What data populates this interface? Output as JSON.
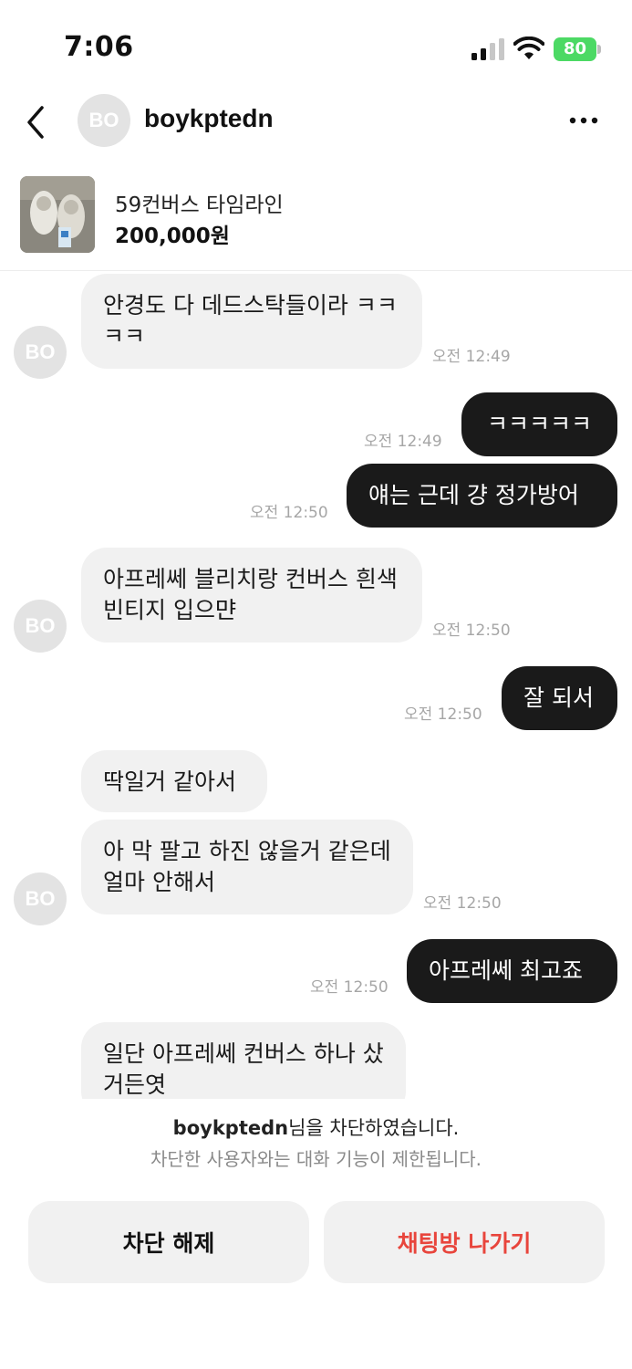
{
  "status_bar": {
    "time": "7:06",
    "battery": "80"
  },
  "header": {
    "back_icon": "chevron-left-icon",
    "avatar_initials": "BO",
    "name": "boykptedn",
    "more_icon": "more-horizontal-icon"
  },
  "product": {
    "title": "59컨버스 타임라인",
    "price": "200,000원"
  },
  "messages": [
    {
      "from": "them",
      "text": "안경도 다 데드스탁들이라 ㅋㅋㅋㅋ",
      "time": "오전 12:49"
    },
    {
      "from": "me",
      "text": "ㅋㅋㅋㅋㅋ",
      "time": "오전 12:49"
    },
    {
      "from": "me",
      "text": "얘는 근데 걍 정가방어",
      "time": "오전 12:50"
    },
    {
      "from": "them",
      "text": "아프레쎄 블리치랑 컨버스 흰색 빈티지 입으먄",
      "time": "오전 12:50"
    },
    {
      "from": "me",
      "text": "잘 되서",
      "time": "오전 12:50"
    },
    {
      "from": "them",
      "text": "딱일거 같아서",
      "time": ""
    },
    {
      "from": "them",
      "text": "아 막 팔고 하진 않을거 같은데 얼마 안해서",
      "time": "오전 12:50"
    },
    {
      "from": "me",
      "text": "아프레쎄 최고죠",
      "time": "오전 12:50"
    },
    {
      "from": "them",
      "text": "일단 아프레쎄 컨버스 하나 샀거든엿",
      "time": ""
    }
  ],
  "notice": {
    "blocked_user": "boykptedn",
    "line1_suffix": "님을 차단하였습니다.",
    "line2": "차단한 사용자와는 대화 기능이 제한됩니다."
  },
  "buttons": {
    "unblock": "차단 해제",
    "leave": "채팅방 나가기"
  },
  "colors": {
    "outgoing_bubble": "#1a1a1a",
    "incoming_bubble": "#f1f1f1",
    "leave_text": "#e8453c",
    "battery": "#4cd964"
  }
}
